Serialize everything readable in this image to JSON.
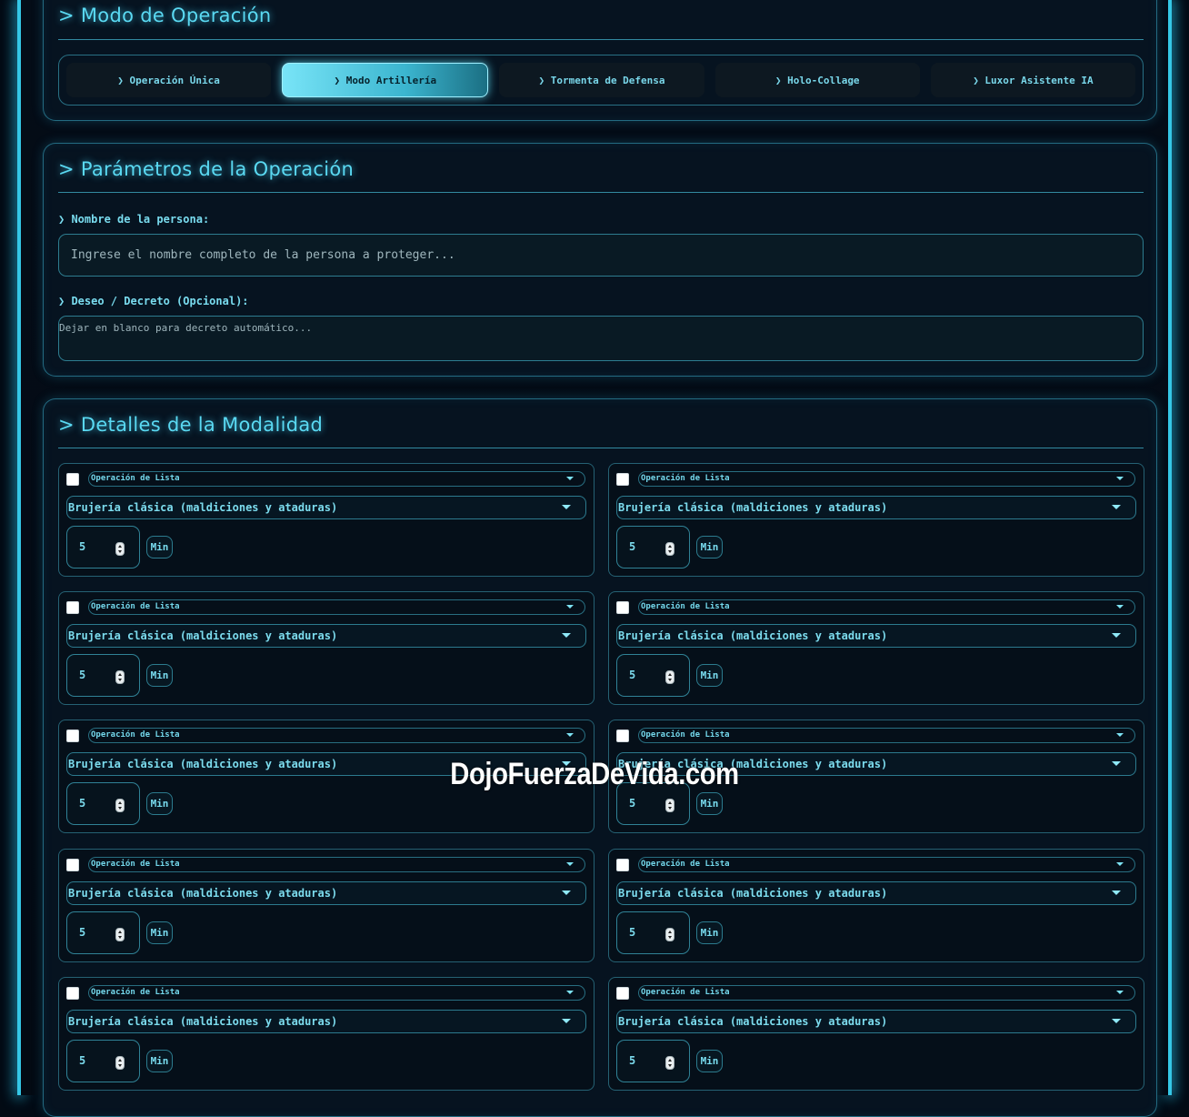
{
  "mode_panel": {
    "title": "> Modo de Operación",
    "tabs": [
      {
        "label": "❯ Operación Única",
        "active": false
      },
      {
        "label": "❯ Modo Artillería",
        "active": true
      },
      {
        "label": "❯ Tormenta de Defensa",
        "active": false
      },
      {
        "label": "❯ Holo-Collage",
        "active": false
      },
      {
        "label": "❯ Luxor Asistente IA",
        "active": false
      }
    ]
  },
  "params_panel": {
    "title": "> Parámetros de la Operación",
    "name_label": "❯ Nombre de la persona:",
    "name_placeholder": "Ingrese el nombre completo de la persona a proteger...",
    "wish_label": "❯ Deseo / Decreto (Opcional):",
    "wish_placeholder": "Dejar en blanco para decreto automático..."
  },
  "details_panel": {
    "title": "> Detalles de la Modalidad",
    "cards": [
      {
        "checked": false,
        "list_label": "Operación de Lista",
        "category": "Brujería clásica (maldiciones y ataduras)",
        "minutes": "5",
        "unit": "Min"
      },
      {
        "checked": false,
        "list_label": "Operación de Lista",
        "category": "Brujería clásica (maldiciones y ataduras)",
        "minutes": "5",
        "unit": "Min"
      },
      {
        "checked": false,
        "list_label": "Operación de Lista",
        "category": "Brujería clásica (maldiciones y ataduras)",
        "minutes": "5",
        "unit": "Min"
      },
      {
        "checked": false,
        "list_label": "Operación de Lista",
        "category": "Brujería clásica (maldiciones y ataduras)",
        "minutes": "5",
        "unit": "Min"
      },
      {
        "checked": false,
        "list_label": "Operación de Lista",
        "category": "Brujería clásica (maldiciones y ataduras)",
        "minutes": "5",
        "unit": "Min"
      },
      {
        "checked": false,
        "list_label": "Operación de Lista",
        "category": "Brujería clásica (maldiciones y ataduras)",
        "minutes": "5",
        "unit": "Min"
      },
      {
        "checked": false,
        "list_label": "Operación de Lista",
        "category": "Brujería clásica (maldiciones y ataduras)",
        "minutes": "5",
        "unit": "Min"
      },
      {
        "checked": false,
        "list_label": "Operación de Lista",
        "category": "Brujería clásica (maldiciones y ataduras)",
        "minutes": "5",
        "unit": "Min"
      },
      {
        "checked": false,
        "list_label": "Operación de Lista",
        "category": "Brujería clásica (maldiciones y ataduras)",
        "minutes": "5",
        "unit": "Min"
      },
      {
        "checked": false,
        "list_label": "Operación de Lista",
        "category": "Brujería clásica (maldiciones y ataduras)",
        "minutes": "5",
        "unit": "Min"
      }
    ]
  },
  "watermark": "DojoFuerzaDeVida.com"
}
